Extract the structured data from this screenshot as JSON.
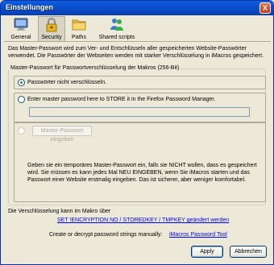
{
  "window": {
    "title": "Einstellungen",
    "close_glyph": "X"
  },
  "toolbar": {
    "items": [
      {
        "label": "General",
        "icon": "monitor-icon"
      },
      {
        "label": "Security",
        "icon": "lock-icon"
      },
      {
        "label": "Paths",
        "icon": "folder-icon"
      },
      {
        "label": "Shared scripts",
        "icon": "users-icon"
      }
    ],
    "active_index": 1
  },
  "intro": "Das Master-Passwort wird zum Ver- und Entschlüsseln aller gespeicherten Website-Passwörter verwendet. Die Passwörter der Webseiten werden mit starker Verschlüsselung in iMacros gespeichert.",
  "group": {
    "legend": "Master-Passwort für Passwortverschlüsselung der Makros (256-Bit)",
    "option1_label": "Passwörter nicht verschlüsseln.",
    "option2_label": "Enter master password here to STORE it in the Firefox Password Manager.",
    "option2_input_value": "",
    "option3_button": "Master-Passwort eingeben",
    "option3_desc": "Geben sie ein temporäres Master-Passwort ein, falls sie NICHT wollen, dass es gespeichert wird. Sie müssen es kann jedes Mal NEU EINGEBEN, wenn Sie iMacros starten und das Passwort einer Website erstmalig eingeben. Das ist sicherer, aber weniger komfortabel."
  },
  "footer": {
    "encryption_note": "Die Verschlüsselung kann im Makro über",
    "encryption_link": "SET !ENCRYPTION NO / STOREDKEY / TMPKEY  geändert werden",
    "tool_prompt": "Create or decrypt password strings manually:",
    "tool_link": "iMacros Password Tool"
  },
  "buttons": {
    "apply": "Apply",
    "cancel": "Abbrechen"
  },
  "colors": {
    "title_bar": "#0a4fd0",
    "link": "#0000ff",
    "radio_checked": "#21a121"
  }
}
